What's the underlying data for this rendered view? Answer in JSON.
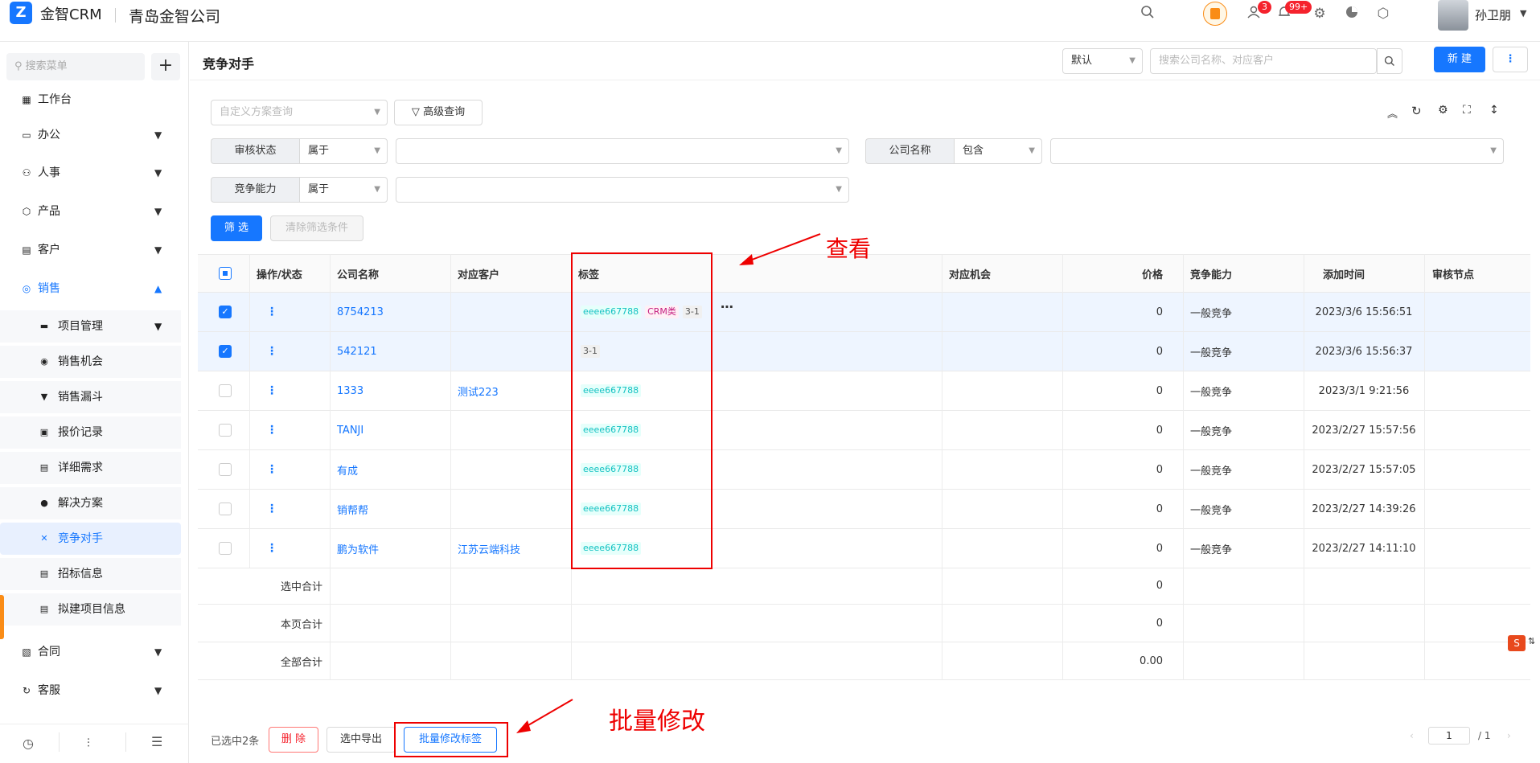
{
  "topbar": {
    "app_name": "金智CRM",
    "company": "青岛金智公司",
    "user_name": "孙卫朋",
    "badge_tasks": "3",
    "badge_notices": "99+"
  },
  "sidebar": {
    "search_placeholder": "搜索菜单",
    "items": [
      {
        "label": "工作台",
        "icon": "dashboard-icon"
      },
      {
        "label": "办公",
        "icon": "office-icon"
      },
      {
        "label": "人事",
        "icon": "people-icon"
      },
      {
        "label": "产品",
        "icon": "cube-icon"
      },
      {
        "label": "客户",
        "icon": "customer-icon"
      },
      {
        "label": "销售",
        "icon": "sales-icon"
      },
      {
        "label": "合同",
        "icon": "contract-icon"
      },
      {
        "label": "客服",
        "icon": "service-icon"
      }
    ],
    "sub_items": [
      {
        "label": "项目管理"
      },
      {
        "label": "销售机会"
      },
      {
        "label": "销售漏斗"
      },
      {
        "label": "报价记录"
      },
      {
        "label": "详细需求"
      },
      {
        "label": "解决方案"
      },
      {
        "label": "竞争对手"
      },
      {
        "label": "招标信息"
      },
      {
        "label": "拟建项目信息"
      }
    ]
  },
  "header": {
    "title": "竞争对手",
    "view_select": "默认",
    "search_placeholder": "搜索公司名称、对应客户",
    "new_button": "新 建"
  },
  "filters": {
    "scheme_placeholder": "自定义方案查询",
    "advanced": "高级查询",
    "f1_label": "审核状态",
    "f1_op": "属于",
    "f2_label": "公司名称",
    "f2_op": "包含",
    "f3_label": "竞争能力",
    "f3_op": "属于",
    "apply": "筛 选",
    "clear": "清除筛选条件"
  },
  "table": {
    "headers": [
      "操作/状态",
      "公司名称",
      "对应客户",
      "标签",
      "对应机会",
      "价格",
      "竞争能力",
      "添加时间",
      "审核节点"
    ],
    "rows": [
      {
        "company": "8754213",
        "customer": "",
        "price": "0",
        "ability": "一般竞争",
        "time": "2023/3/6 15:56:51"
      },
      {
        "company": "542121",
        "customer": "",
        "price": "0",
        "ability": "一般竞争",
        "time": "2023/3/6 15:56:37"
      },
      {
        "company": "1333",
        "customer": "测试223",
        "price": "0",
        "ability": "一般竞争",
        "time": "2023/3/1 9:21:56"
      },
      {
        "company": "TANJI",
        "customer": "",
        "price": "0",
        "ability": "一般竞争",
        "time": "2023/2/27 15:57:56"
      },
      {
        "company": "有成",
        "customer": "",
        "price": "0",
        "ability": "一般竞争",
        "time": "2023/2/27 15:57:05"
      },
      {
        "company": "销帮帮",
        "customer": "",
        "price": "0",
        "ability": "一般竞争",
        "time": "2023/2/27 14:39:26"
      },
      {
        "company": "鹏为软件",
        "customer": "江苏云端科技",
        "price": "0",
        "ability": "一般竞争",
        "time": "2023/2/27 14:11:10"
      }
    ],
    "tags": {
      "t1": "eeee667788",
      "t2": "CRM类",
      "t3": "3-1"
    },
    "summary": [
      {
        "label": "选中合计",
        "price": "0"
      },
      {
        "label": "本页合计",
        "price": "0"
      },
      {
        "label": "全部合计",
        "price": "0.00"
      }
    ]
  },
  "footer": {
    "selected": "已选中2条",
    "delete": "删 除",
    "export": "选中导出",
    "batch_tag": "批量修改标签",
    "page": "1",
    "total_pages": "/ 1"
  },
  "annotations": {
    "view": "查看",
    "batch": "批量修改"
  },
  "colors": {
    "primary": "#1677ff",
    "annotation": "#e00000"
  }
}
